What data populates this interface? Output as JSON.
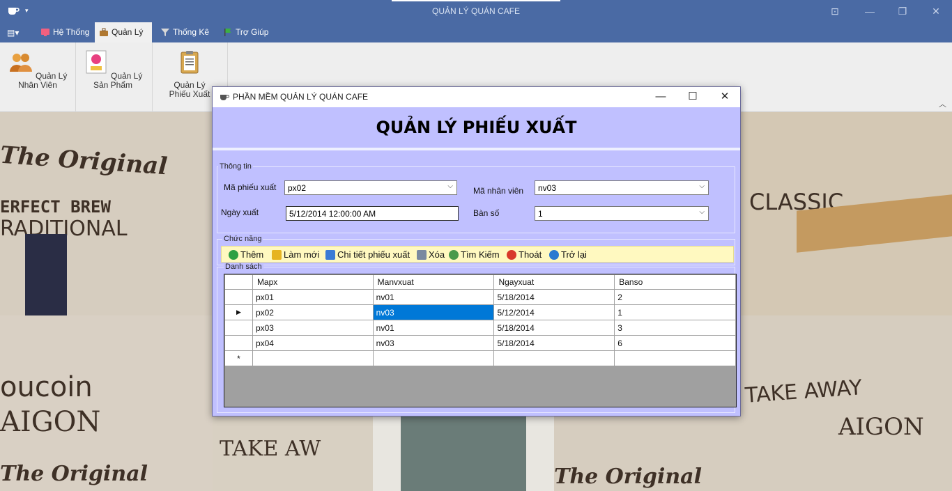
{
  "window": {
    "title": "QUẢN LÝ QUÁN CAFE",
    "quick_access_arrow": "▾",
    "controls": {
      "ribbon": "⊡",
      "minimize": "—",
      "restore": "❐",
      "close": "✕"
    }
  },
  "ribbon": {
    "menu_button": "▤▾",
    "tabs": [
      {
        "label": "Hệ Thống",
        "icon": "computer-icon"
      },
      {
        "label": "Quản Lý",
        "icon": "briefcase-icon",
        "active": true
      },
      {
        "label": "Thống Kê",
        "icon": "funnel-icon"
      },
      {
        "label": "Trợ Giúp",
        "icon": "flag-icon"
      }
    ],
    "buttons": [
      {
        "label": "Quản Lý Nhân Viên",
        "icon": "users-icon"
      },
      {
        "label": "Quản Lý Sản Phẩm",
        "icon": "products-icon"
      },
      {
        "label_line1": "Quản Lý",
        "label_line2": "Phiếu Xuất",
        "icon": "clipboard-icon"
      }
    ],
    "collapse_glyph": "︿"
  },
  "background_text": {
    "t1": "The Original",
    "t2": "ERFECT BREW",
    "t3": "RADITIONAL",
    "t4": "CL",
    "t5": "CLASSIC",
    "t6": "oucoin",
    "t7": "AIGON",
    "t8": "The Original",
    "t9": "TAKE AW",
    "t10": "TAKE AWAY",
    "t11": "AIGON",
    "t12": "The Original"
  },
  "dialog": {
    "title": "PHẦN MỀM QUẢN LÝ QUÁN CAFE",
    "controls": {
      "minimize": "—",
      "maximize": "☐",
      "close": "✕"
    },
    "heading": "QUẢN LÝ PHIẾU XUẤT",
    "info_group": {
      "legend": "Thông tin",
      "ma_phieu_xuat_label": "Mã phiếu xuất",
      "ma_phieu_xuat_value": "px02",
      "ma_nhan_vien_label": "Mã nhân viên",
      "ma_nhan_vien_value": "nv03",
      "ngay_xuat_label": "Ngày xuất",
      "ngay_xuat_value": "5/12/2014 12:00:00 AM",
      "ban_so_label": "Bàn số",
      "ban_so_value": "1",
      "dropdown_arrow": "⌵"
    },
    "function_group": {
      "legend": "Chức năng",
      "buttons": [
        {
          "label": "Thêm",
          "icon": "add-icon",
          "color": "#2ea043"
        },
        {
          "label": "Làm mới",
          "icon": "folder-icon",
          "color": "#e6b422"
        },
        {
          "label": "Chi tiết phiếu xuất",
          "icon": "books-icon",
          "color": "#3a7bd5"
        },
        {
          "label": "Xóa",
          "icon": "trash-icon",
          "color": "#7a8aa0"
        },
        {
          "label": "Tìm Kiếm",
          "icon": "magnifier-icon",
          "color": "#4a9a4a"
        },
        {
          "label": "Thoát",
          "icon": "exit-icon",
          "color": "#d83a2a"
        },
        {
          "label": "Trở lại",
          "icon": "undo-icon",
          "color": "#2a7ad0"
        }
      ]
    },
    "list_group": {
      "legend": "Danh sách",
      "columns": [
        "Mapx",
        "Manvxuat",
        "Ngayxuat",
        "Banso"
      ],
      "rows": [
        [
          "px01",
          "nv01",
          "5/18/2014",
          "2"
        ],
        [
          "px02",
          "nv03",
          "5/12/2014",
          "1"
        ],
        [
          "px03",
          "nv01",
          "5/18/2014",
          "3"
        ],
        [
          "px04",
          "nv03",
          "5/18/2014",
          "6"
        ]
      ],
      "current_row_marker": "▶",
      "new_row_marker": "*"
    }
  }
}
